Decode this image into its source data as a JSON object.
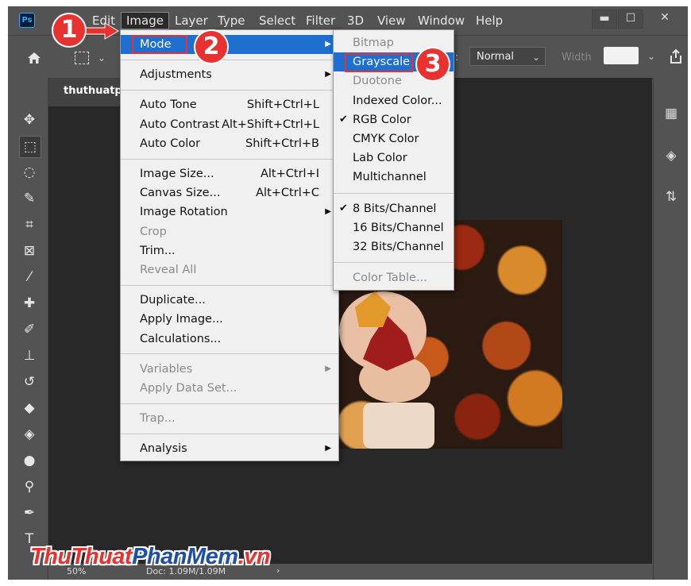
{
  "menubar": {
    "logo": "Ps",
    "items": [
      "Image",
      "Layer",
      "Type",
      "Select",
      "Filter",
      "3D",
      "View",
      "Window",
      "Help"
    ],
    "partial_item": "Edit"
  },
  "window_controls": [
    "▬",
    "☐",
    "✕"
  ],
  "options_bar": {
    "mode_value": "Normal",
    "width_label": "Width"
  },
  "document": {
    "tab_title": "thuthuatpl",
    "zoom": "50%",
    "doc_info": "Doc: 1.09M/1.09M"
  },
  "image_menu": {
    "groups": [
      [
        {
          "label": "Mode",
          "submenu": true,
          "highlighted": true
        }
      ],
      [
        {
          "label": "Adjustments",
          "submenu": true
        }
      ],
      [
        {
          "label": "Auto Tone",
          "shortcut": "Shift+Ctrl+L"
        },
        {
          "label": "Auto Contrast",
          "shortcut": "Alt+Shift+Ctrl+L"
        },
        {
          "label": "Auto Color",
          "shortcut": "Shift+Ctrl+B"
        }
      ],
      [
        {
          "label": "Image Size...",
          "shortcut": "Alt+Ctrl+I"
        },
        {
          "label": "Canvas Size...",
          "shortcut": "Alt+Ctrl+C"
        },
        {
          "label": "Image Rotation",
          "submenu": true
        },
        {
          "label": "Crop",
          "disabled": true
        },
        {
          "label": "Trim..."
        },
        {
          "label": "Reveal All",
          "disabled": true
        }
      ],
      [
        {
          "label": "Duplicate..."
        },
        {
          "label": "Apply Image..."
        },
        {
          "label": "Calculations..."
        }
      ],
      [
        {
          "label": "Variables",
          "submenu": true,
          "disabled": true
        },
        {
          "label": "Apply Data Set...",
          "disabled": true
        }
      ],
      [
        {
          "label": "Trap...",
          "disabled": true
        }
      ],
      [
        {
          "label": "Analysis",
          "submenu": true
        }
      ]
    ]
  },
  "mode_submenu": {
    "groups": [
      [
        {
          "label": "Bitmap",
          "disabled": true
        },
        {
          "label": "Grayscale",
          "highlighted": true
        },
        {
          "label": "Duotone",
          "disabled": true
        },
        {
          "label": "Indexed Color..."
        },
        {
          "label": "RGB Color",
          "checked": true
        },
        {
          "label": "CMYK Color"
        },
        {
          "label": "Lab Color"
        },
        {
          "label": "Multichannel"
        }
      ],
      [
        {
          "label": "8 Bits/Channel",
          "checked": true
        },
        {
          "label": "16 Bits/Channel"
        },
        {
          "label": "32 Bits/Channel"
        }
      ],
      [
        {
          "label": "Color Table...",
          "disabled": true
        }
      ]
    ]
  },
  "annotations": {
    "steps": [
      "1",
      "2",
      "3"
    ],
    "color": "#e8322f"
  },
  "watermark": {
    "part1": "ThuThuat",
    "part2": "PhanMem",
    "part3": ".vn"
  },
  "colors": {
    "highlight": "#1e6fd0",
    "ps_blue": "#31a8ff",
    "ui_gray": "#535353"
  }
}
